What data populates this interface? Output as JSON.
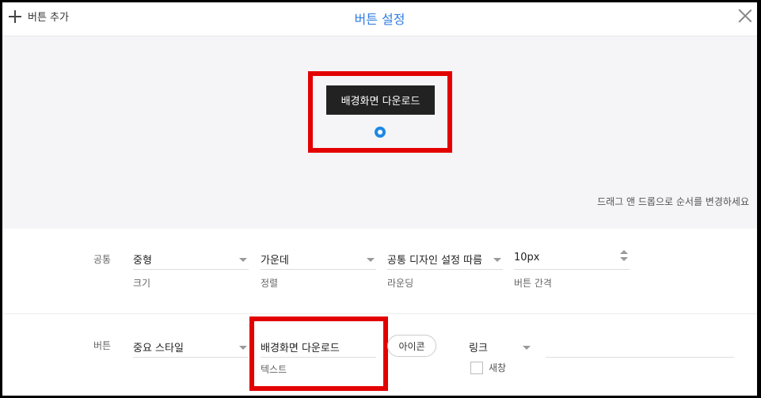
{
  "header": {
    "add_button_label": "버튼 추가",
    "title": "버튼 설정"
  },
  "preview": {
    "button_label": "배경화면 다운로드",
    "hint": "드래그 앤 드롭으로 순서를 변경하세요"
  },
  "common": {
    "label": "공통",
    "size": {
      "value": "중형",
      "caption": "크기"
    },
    "align": {
      "value": "가운데",
      "caption": "정렬"
    },
    "rounding": {
      "value": "공통 디자인 설정 따름",
      "caption": "라운딩"
    },
    "spacing": {
      "value": "10px",
      "caption": "버튼 간격"
    }
  },
  "button": {
    "label": "버튼",
    "style": {
      "value": "중요 스타일"
    },
    "text": {
      "value": "배경화면 다운로드",
      "caption": "텍스트"
    },
    "icon_label": "아이콘",
    "link": {
      "value": "링크"
    },
    "new_window_label": "새창"
  },
  "colors": {
    "accent": "#2f7de1",
    "highlight": "#e30000",
    "button_bg": "#222222"
  }
}
